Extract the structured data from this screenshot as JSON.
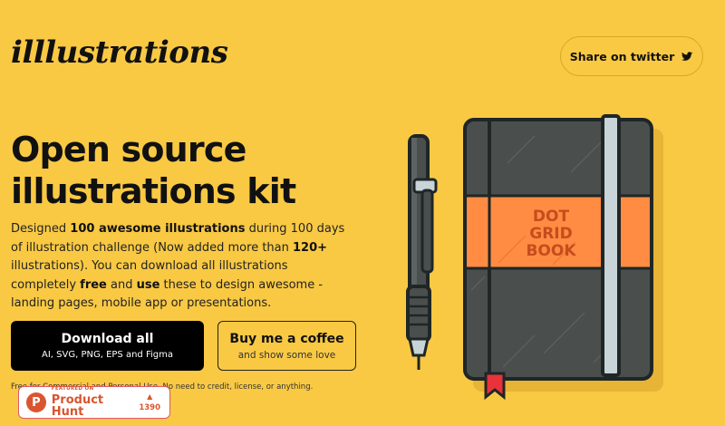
{
  "header": {
    "logo": "illlustrations",
    "share_label": "Share on twitter",
    "share_icon": "twitter-icon"
  },
  "hero": {
    "title_line1": "Open source",
    "title_line2": "illustrations kit",
    "desc": {
      "t1": "Designed ",
      "b1": "100 awesome illustrations",
      "t2": " during 100 days of illustration challenge (Now added more than ",
      "b2": "120+",
      "t3": " illustrations). You can download all illustrations completely ",
      "b3": "free",
      "t4": " and ",
      "b4": "use",
      "t5": " these to design awesome - landing pages, mobile app or presentations."
    },
    "download": {
      "label": "Download all",
      "formats": "AI, SVG, PNG, EPS and Figma"
    },
    "coffee": {
      "label": "Buy me a coffee",
      "sub": "and show some love"
    },
    "free_note": "Free for Commercial and Personal Use. No need to credit, license, or anything."
  },
  "product_hunt": {
    "featured": "FEATURED ON",
    "name": "Product Hunt",
    "logo_letter": "P",
    "votes": "1390",
    "arrow": "▲"
  },
  "illustration": {
    "book_label_1": "DOT",
    "book_label_2": "GRID",
    "book_label_3": "BOOK",
    "colors": {
      "book": "#4a4f4e",
      "band": "#ff8c42",
      "outline": "#1f2626",
      "elastic": "#c8d4d8",
      "bookmark": "#e8333a",
      "background": "#f9c944"
    }
  }
}
